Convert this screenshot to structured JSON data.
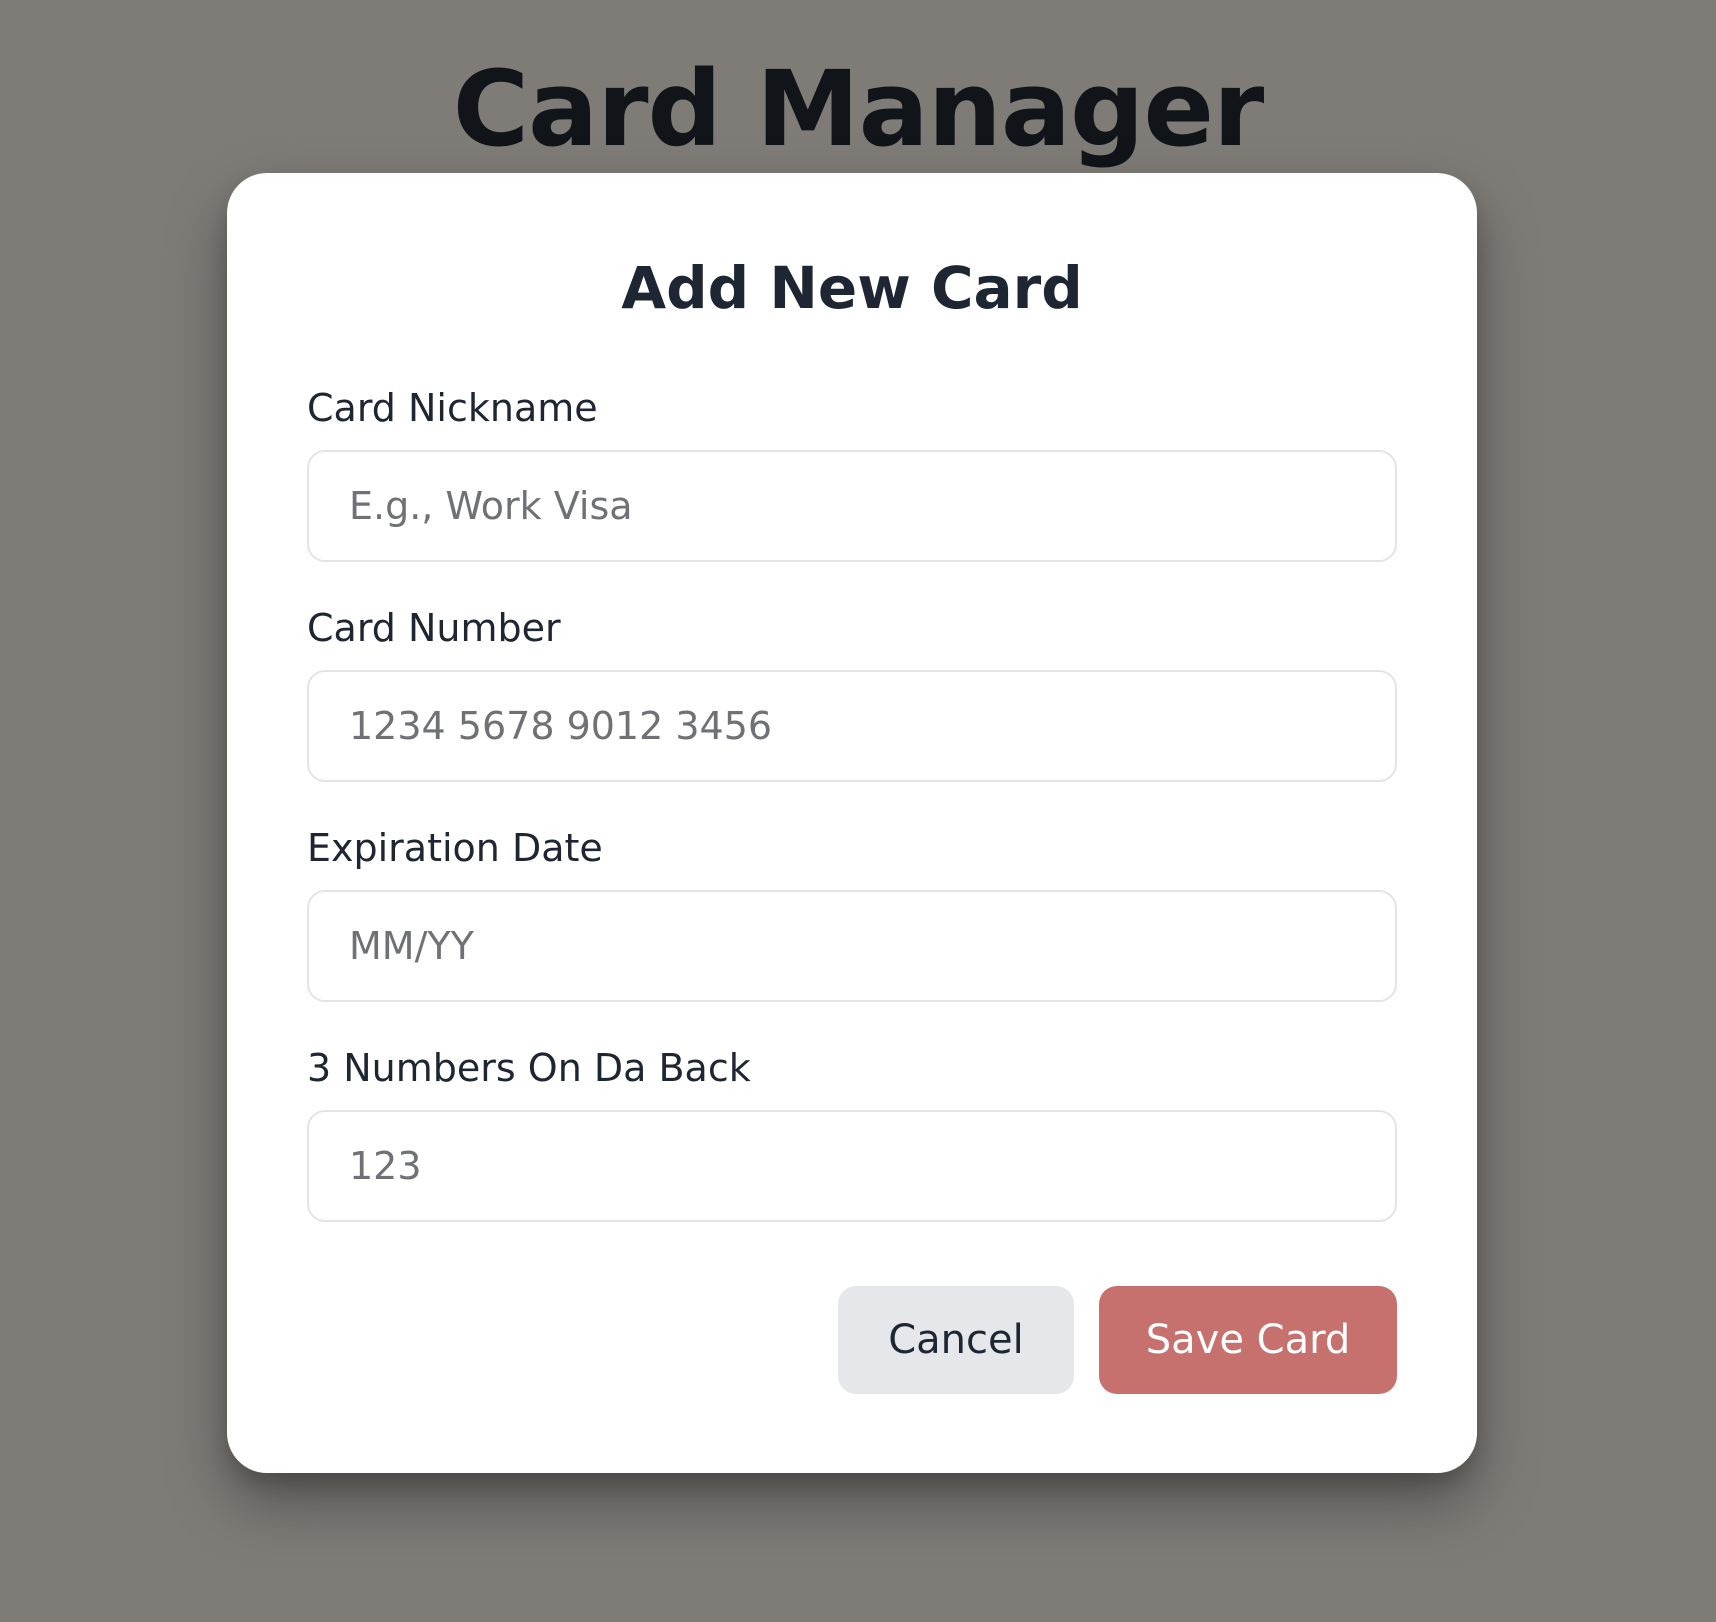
{
  "page": {
    "title": "Card Manager"
  },
  "modal": {
    "title": "Add New Card",
    "fields": [
      {
        "label": "Card Nickname",
        "placeholder": "E.g., Work Visa",
        "value": ""
      },
      {
        "label": "Card Number",
        "placeholder": "1234 5678 9012 3456",
        "value": ""
      },
      {
        "label": "Expiration Date",
        "placeholder": "MM/YY",
        "value": ""
      },
      {
        "label": "3 Numbers On Da Back",
        "placeholder": "123",
        "value": ""
      }
    ],
    "cancel_label": "Cancel",
    "save_label": "Save Card"
  },
  "colors": {
    "backdrop": "#7f7c78",
    "modal_background": "#ffffff",
    "primary_button": "#c6716d",
    "secondary_button": "#e5e7eb",
    "text": "#1f2633"
  }
}
